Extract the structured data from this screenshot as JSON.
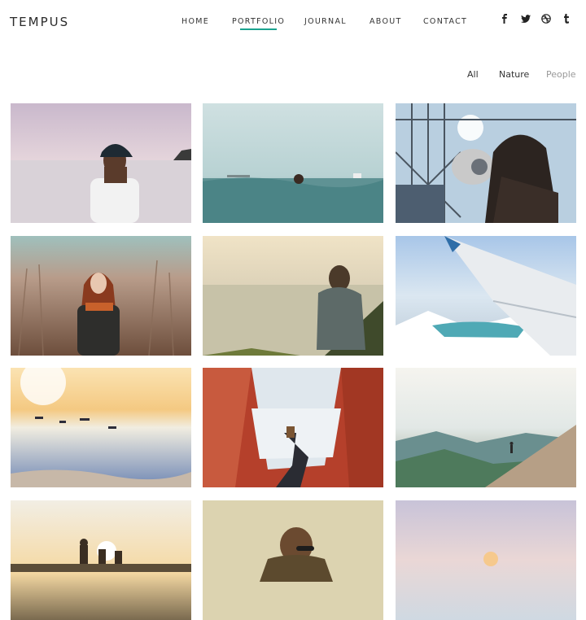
{
  "header": {
    "logo": "TEMPUS",
    "nav": [
      "HOME",
      "PORTFOLIO",
      "JOURNAL",
      "ABOUT",
      "CONTACT"
    ],
    "active_nav": "PORTFOLIO",
    "accent_color": "#1aa38f",
    "social_icons": [
      "facebook-icon",
      "twitter-icon",
      "dribbble-icon",
      "tumblr-icon"
    ]
  },
  "filters": [
    "All",
    "Nature",
    "People"
  ],
  "gallery": [
    {
      "icon": "photo-girl-cap-sea"
    },
    {
      "icon": "photo-swimmer-sea"
    },
    {
      "icon": "photo-observation-deck-binoculars"
    },
    {
      "icon": "photo-woman-field"
    },
    {
      "icon": "photo-woman-sitting-lake"
    },
    {
      "icon": "photo-airplane-wing-mountains"
    },
    {
      "icon": "photo-surfers-sunset"
    },
    {
      "icon": "photo-tent-view-feet"
    },
    {
      "icon": "photo-hiker-mountain-ridge"
    },
    {
      "icon": "photo-people-sunset-silhouettes"
    },
    {
      "icon": "photo-man-sunglasses"
    },
    {
      "icon": "photo-pastel-sky-sea"
    }
  ]
}
